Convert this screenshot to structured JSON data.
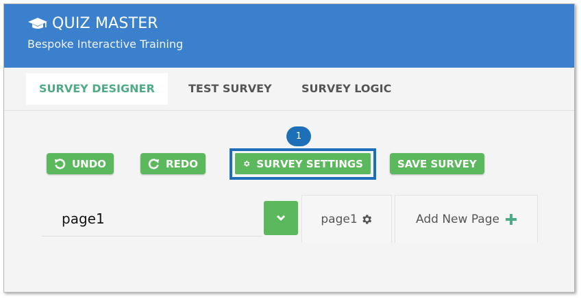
{
  "app": {
    "title": "QUIZ MASTER",
    "subtitle": "Bespoke Interactive Training"
  },
  "tabs": [
    {
      "label": "SURVEY DESIGNER",
      "active": true
    },
    {
      "label": "TEST SURVEY",
      "active": false
    },
    {
      "label": "SURVEY LOGIC",
      "active": false
    }
  ],
  "callout": {
    "number": "1"
  },
  "toolbar": {
    "undo_label": "UNDO",
    "redo_label": "REDO",
    "settings_label": "SURVEY SETTINGS",
    "save_label": "SAVE SURVEY"
  },
  "pages": {
    "selected": "page1",
    "tab_label": "page1",
    "add_label": "Add New Page"
  },
  "colors": {
    "header": "#3a80cc",
    "accent_green": "#5cb85c",
    "active_tab_text": "#4faa86",
    "callout_blue": "#1d70b8"
  },
  "icons": [
    "graduation-cap-icon",
    "undo-icon",
    "redo-icon",
    "gear-icon",
    "chevron-down-icon",
    "plus-icon"
  ]
}
